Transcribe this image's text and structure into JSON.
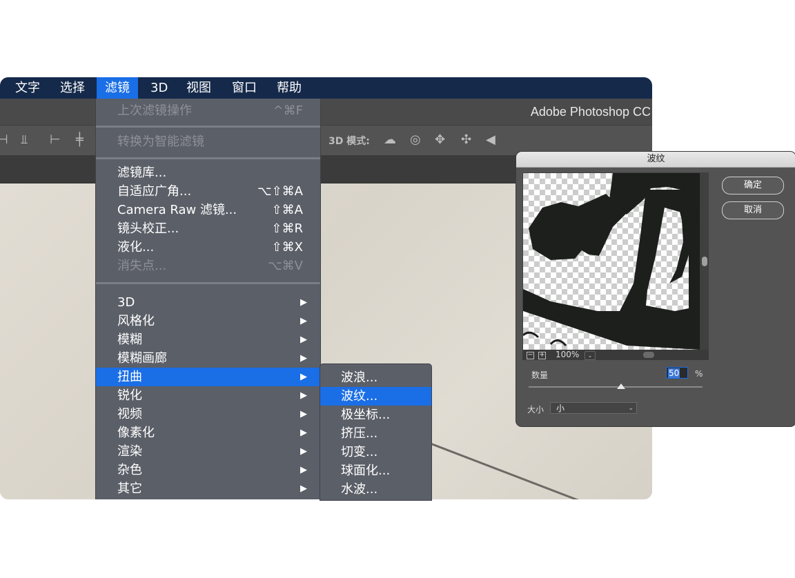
{
  "app": {
    "title": "Adobe Photoshop CC",
    "menubar": [
      "文字",
      "选择",
      "滤镜",
      "3D",
      "视图",
      "窗口",
      "帮助"
    ],
    "selected_menu": "滤镜",
    "options_bar_label": "3D 模式:"
  },
  "filter_menu": {
    "group1": [
      {
        "label": "上次滤镜操作",
        "shortcut": "^⌘F",
        "disabled": true
      }
    ],
    "group2": [
      {
        "label": "转换为智能滤镜",
        "disabled": true
      }
    ],
    "group3": [
      {
        "label": "滤镜库...",
        "shortcut": ""
      },
      {
        "label": "自适应广角...",
        "shortcut": "⌥⇧⌘A"
      },
      {
        "label": "Camera Raw 滤镜...",
        "shortcut": "⇧⌘A"
      },
      {
        "label": "镜头校正...",
        "shortcut": "⇧⌘R"
      },
      {
        "label": "液化...",
        "shortcut": "⇧⌘X"
      },
      {
        "label": "消失点...",
        "shortcut": "⌥⌘V",
        "disabled": true
      }
    ],
    "group4": [
      {
        "label": "3D"
      },
      {
        "label": "风格化"
      },
      {
        "label": "模糊"
      },
      {
        "label": "模糊画廊"
      },
      {
        "label": "扭曲",
        "selected": true
      },
      {
        "label": "锐化"
      },
      {
        "label": "视频"
      },
      {
        "label": "像素化"
      },
      {
        "label": "渲染"
      },
      {
        "label": "杂色"
      },
      {
        "label": "其它"
      }
    ],
    "submenu_arrow": "▶"
  },
  "distort_submenu": [
    {
      "label": "波浪..."
    },
    {
      "label": "波纹...",
      "selected": true
    },
    {
      "label": "极坐标..."
    },
    {
      "label": "挤压..."
    },
    {
      "label": "切变..."
    },
    {
      "label": "球面化..."
    },
    {
      "label": "水波..."
    }
  ],
  "dialog": {
    "title": "波纹",
    "ok_label": "确定",
    "cancel_label": "取消",
    "zoom": "100%",
    "zoom_minus": "−",
    "zoom_plus": "+",
    "amount_label": "数量",
    "amount_value": "50",
    "amount_unit": "%",
    "amount_slider_fraction": 0.53,
    "size_label": "大小",
    "size_value": "小"
  },
  "colors": {
    "menubar_bg": "#15294a",
    "selection": "#1a6ee6",
    "menu_bg": "#5b5f68"
  }
}
